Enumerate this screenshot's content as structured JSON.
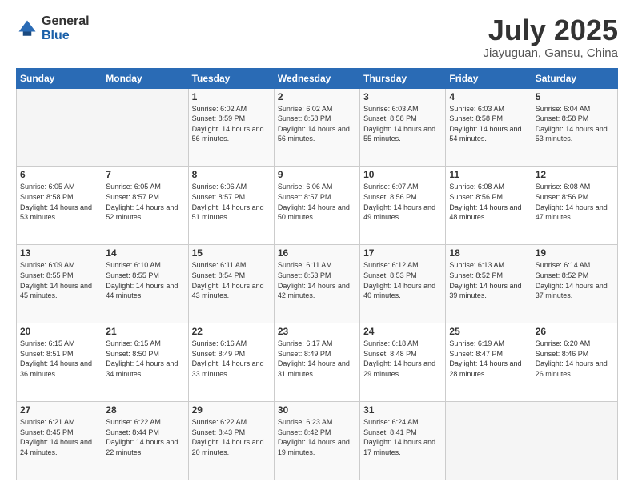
{
  "logo": {
    "general": "General",
    "blue": "Blue"
  },
  "title": "July 2025",
  "subtitle": "Jiayuguan, Gansu, China",
  "weekdays": [
    "Sunday",
    "Monday",
    "Tuesday",
    "Wednesday",
    "Thursday",
    "Friday",
    "Saturday"
  ],
  "weeks": [
    [
      {
        "day": "",
        "sunrise": "",
        "sunset": "",
        "daylight": ""
      },
      {
        "day": "",
        "sunrise": "",
        "sunset": "",
        "daylight": ""
      },
      {
        "day": "1",
        "sunrise": "Sunrise: 6:02 AM",
        "sunset": "Sunset: 8:59 PM",
        "daylight": "Daylight: 14 hours and 56 minutes."
      },
      {
        "day": "2",
        "sunrise": "Sunrise: 6:02 AM",
        "sunset": "Sunset: 8:58 PM",
        "daylight": "Daylight: 14 hours and 56 minutes."
      },
      {
        "day": "3",
        "sunrise": "Sunrise: 6:03 AM",
        "sunset": "Sunset: 8:58 PM",
        "daylight": "Daylight: 14 hours and 55 minutes."
      },
      {
        "day": "4",
        "sunrise": "Sunrise: 6:03 AM",
        "sunset": "Sunset: 8:58 PM",
        "daylight": "Daylight: 14 hours and 54 minutes."
      },
      {
        "day": "5",
        "sunrise": "Sunrise: 6:04 AM",
        "sunset": "Sunset: 8:58 PM",
        "daylight": "Daylight: 14 hours and 53 minutes."
      }
    ],
    [
      {
        "day": "6",
        "sunrise": "Sunrise: 6:05 AM",
        "sunset": "Sunset: 8:58 PM",
        "daylight": "Daylight: 14 hours and 53 minutes."
      },
      {
        "day": "7",
        "sunrise": "Sunrise: 6:05 AM",
        "sunset": "Sunset: 8:57 PM",
        "daylight": "Daylight: 14 hours and 52 minutes."
      },
      {
        "day": "8",
        "sunrise": "Sunrise: 6:06 AM",
        "sunset": "Sunset: 8:57 PM",
        "daylight": "Daylight: 14 hours and 51 minutes."
      },
      {
        "day": "9",
        "sunrise": "Sunrise: 6:06 AM",
        "sunset": "Sunset: 8:57 PM",
        "daylight": "Daylight: 14 hours and 50 minutes."
      },
      {
        "day": "10",
        "sunrise": "Sunrise: 6:07 AM",
        "sunset": "Sunset: 8:56 PM",
        "daylight": "Daylight: 14 hours and 49 minutes."
      },
      {
        "day": "11",
        "sunrise": "Sunrise: 6:08 AM",
        "sunset": "Sunset: 8:56 PM",
        "daylight": "Daylight: 14 hours and 48 minutes."
      },
      {
        "day": "12",
        "sunrise": "Sunrise: 6:08 AM",
        "sunset": "Sunset: 8:56 PM",
        "daylight": "Daylight: 14 hours and 47 minutes."
      }
    ],
    [
      {
        "day": "13",
        "sunrise": "Sunrise: 6:09 AM",
        "sunset": "Sunset: 8:55 PM",
        "daylight": "Daylight: 14 hours and 45 minutes."
      },
      {
        "day": "14",
        "sunrise": "Sunrise: 6:10 AM",
        "sunset": "Sunset: 8:55 PM",
        "daylight": "Daylight: 14 hours and 44 minutes."
      },
      {
        "day": "15",
        "sunrise": "Sunrise: 6:11 AM",
        "sunset": "Sunset: 8:54 PM",
        "daylight": "Daylight: 14 hours and 43 minutes."
      },
      {
        "day": "16",
        "sunrise": "Sunrise: 6:11 AM",
        "sunset": "Sunset: 8:53 PM",
        "daylight": "Daylight: 14 hours and 42 minutes."
      },
      {
        "day": "17",
        "sunrise": "Sunrise: 6:12 AM",
        "sunset": "Sunset: 8:53 PM",
        "daylight": "Daylight: 14 hours and 40 minutes."
      },
      {
        "day": "18",
        "sunrise": "Sunrise: 6:13 AM",
        "sunset": "Sunset: 8:52 PM",
        "daylight": "Daylight: 14 hours and 39 minutes."
      },
      {
        "day": "19",
        "sunrise": "Sunrise: 6:14 AM",
        "sunset": "Sunset: 8:52 PM",
        "daylight": "Daylight: 14 hours and 37 minutes."
      }
    ],
    [
      {
        "day": "20",
        "sunrise": "Sunrise: 6:15 AM",
        "sunset": "Sunset: 8:51 PM",
        "daylight": "Daylight: 14 hours and 36 minutes."
      },
      {
        "day": "21",
        "sunrise": "Sunrise: 6:15 AM",
        "sunset": "Sunset: 8:50 PM",
        "daylight": "Daylight: 14 hours and 34 minutes."
      },
      {
        "day": "22",
        "sunrise": "Sunrise: 6:16 AM",
        "sunset": "Sunset: 8:49 PM",
        "daylight": "Daylight: 14 hours and 33 minutes."
      },
      {
        "day": "23",
        "sunrise": "Sunrise: 6:17 AM",
        "sunset": "Sunset: 8:49 PM",
        "daylight": "Daylight: 14 hours and 31 minutes."
      },
      {
        "day": "24",
        "sunrise": "Sunrise: 6:18 AM",
        "sunset": "Sunset: 8:48 PM",
        "daylight": "Daylight: 14 hours and 29 minutes."
      },
      {
        "day": "25",
        "sunrise": "Sunrise: 6:19 AM",
        "sunset": "Sunset: 8:47 PM",
        "daylight": "Daylight: 14 hours and 28 minutes."
      },
      {
        "day": "26",
        "sunrise": "Sunrise: 6:20 AM",
        "sunset": "Sunset: 8:46 PM",
        "daylight": "Daylight: 14 hours and 26 minutes."
      }
    ],
    [
      {
        "day": "27",
        "sunrise": "Sunrise: 6:21 AM",
        "sunset": "Sunset: 8:45 PM",
        "daylight": "Daylight: 14 hours and 24 minutes."
      },
      {
        "day": "28",
        "sunrise": "Sunrise: 6:22 AM",
        "sunset": "Sunset: 8:44 PM",
        "daylight": "Daylight: 14 hours and 22 minutes."
      },
      {
        "day": "29",
        "sunrise": "Sunrise: 6:22 AM",
        "sunset": "Sunset: 8:43 PM",
        "daylight": "Daylight: 14 hours and 20 minutes."
      },
      {
        "day": "30",
        "sunrise": "Sunrise: 6:23 AM",
        "sunset": "Sunset: 8:42 PM",
        "daylight": "Daylight: 14 hours and 19 minutes."
      },
      {
        "day": "31",
        "sunrise": "Sunrise: 6:24 AM",
        "sunset": "Sunset: 8:41 PM",
        "daylight": "Daylight: 14 hours and 17 minutes."
      },
      {
        "day": "",
        "sunrise": "",
        "sunset": "",
        "daylight": ""
      },
      {
        "day": "",
        "sunrise": "",
        "sunset": "",
        "daylight": ""
      }
    ]
  ]
}
